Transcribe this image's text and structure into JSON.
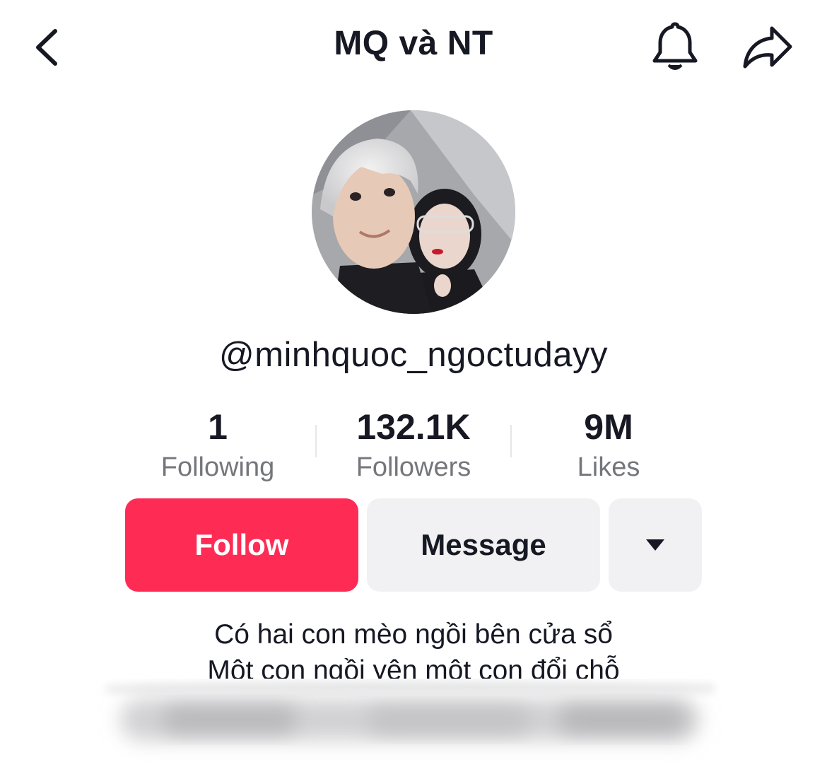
{
  "header": {
    "title": "MQ và NT",
    "back_icon": "chevron-left-icon",
    "bell_icon": "bell-icon",
    "share_icon": "share-arrow-icon"
  },
  "profile": {
    "username": "@minhquoc_ngoctudayy",
    "avatar_description_icon": "profile-avatar"
  },
  "stats": [
    {
      "value": "1",
      "label": "Following"
    },
    {
      "value": "132.1K",
      "label": "Followers"
    },
    {
      "value": "9M",
      "label": "Likes"
    }
  ],
  "actions": {
    "follow_label": "Follow",
    "message_label": "Message",
    "more_icon": "caret-down-icon"
  },
  "bio": {
    "line1": "Có hai con mèo ngồi bên cửa sổ",
    "line2": "Một con ngồi yên một con đổi chỗ"
  },
  "colors": {
    "accent": "#fe2c55",
    "text": "#161823",
    "muted": "#75767c",
    "button_gray": "#f1f1f3"
  }
}
